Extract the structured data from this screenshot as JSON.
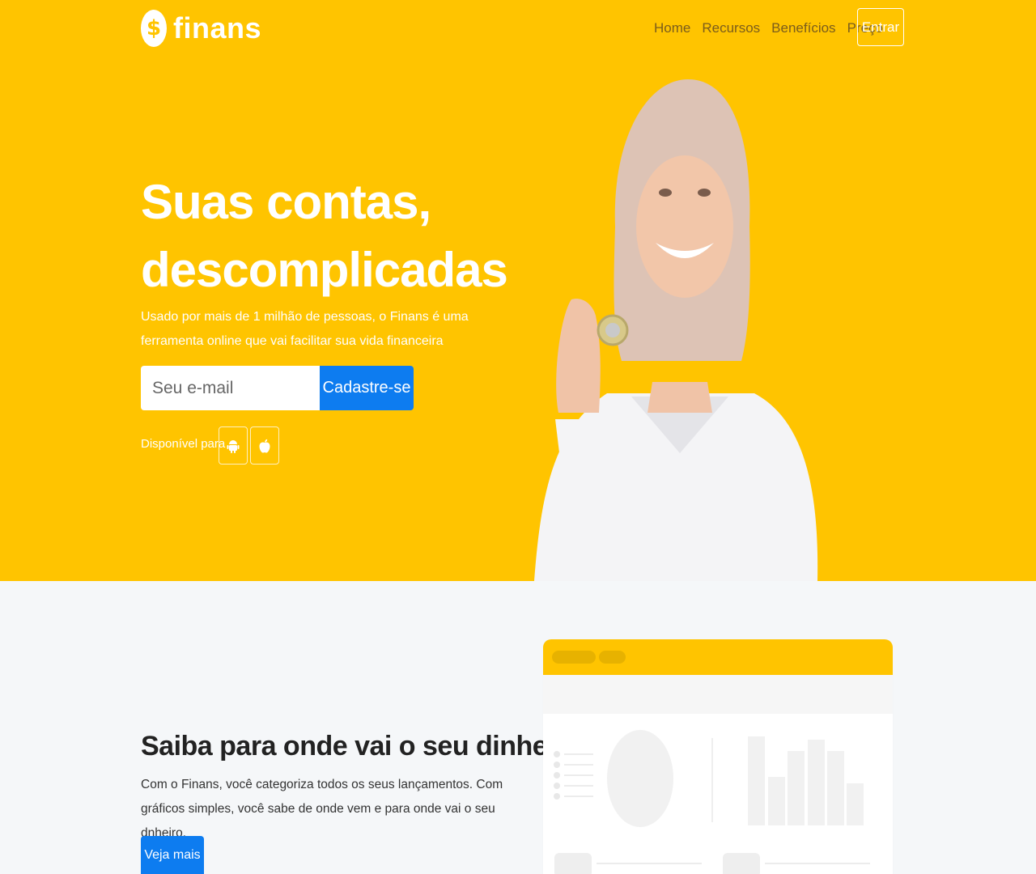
{
  "brand": {
    "name": "finans",
    "logo_symbol": "$"
  },
  "nav": {
    "items": [
      "Home",
      "Recursos",
      "Benefícios",
      "Preço"
    ],
    "login_label": "Entrar"
  },
  "hero": {
    "title_line1": "Suas contas,",
    "title_line2": "descomplicadas",
    "description": "Usado por mais de 1 milhão de pessoas, o Finans é uma ferramenta online que vai facilitar sua vida financeira",
    "email_placeholder": "Seu e-mail",
    "cta_label": "Cadastre-se",
    "available_label": "Disponível para",
    "stores": [
      "android-icon",
      "apple-icon"
    ]
  },
  "section": {
    "title": "Saiba para onde vai o seu dinheiro",
    "description": "Com o Finans, você categoriza todos os seus lançamentos. Com gráficos simples, você sabe de onde vem e para onde vai o seu dnheiro.",
    "cta_label": "Veja mais"
  },
  "colors": {
    "brand_yellow": "#ffc400",
    "primary_blue": "#0d7cf0",
    "nav_text": "#7b5d1c",
    "section_bg": "#f5f7f9"
  }
}
